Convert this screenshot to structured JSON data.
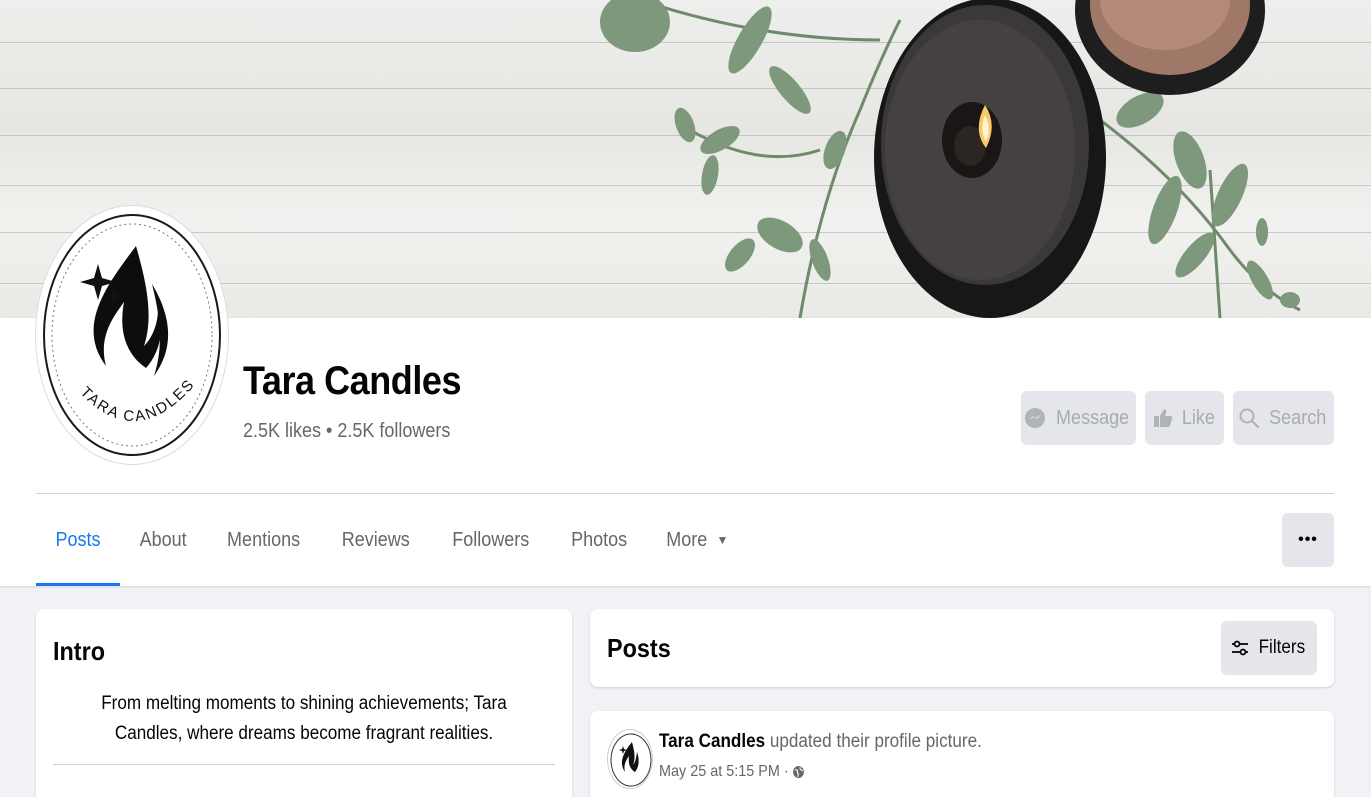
{
  "page": {
    "name": "Tara Candles",
    "stats": "2.5K likes • 2.5K followers",
    "logo_text": "TARA CANDLES"
  },
  "actions": {
    "message": "Message",
    "like": "Like",
    "search": "Search"
  },
  "tabs": [
    {
      "label": "Posts",
      "active": true
    },
    {
      "label": "About"
    },
    {
      "label": "Mentions"
    },
    {
      "label": "Reviews"
    },
    {
      "label": "Followers"
    },
    {
      "label": "Photos"
    },
    {
      "label": "More"
    }
  ],
  "more_options": "•••",
  "intro": {
    "title": "Intro",
    "bio": "From melting moments to shining achievements; Tara Candles, where dreams become fragrant realities."
  },
  "posts": {
    "title": "Posts",
    "filters_label": "Filters",
    "items": [
      {
        "author": "Tara Candles",
        "action": "updated their profile picture.",
        "timestamp": "May 25 at 5:15 PM ·"
      }
    ]
  },
  "colors": {
    "accent": "#1877f2",
    "muted_text": "#65676b",
    "button_bg": "#e4e6eb",
    "page_bg": "#f0f2f5"
  },
  "icons": [
    "messenger-icon",
    "thumbs-up-icon",
    "search-icon",
    "chevron-down-icon",
    "ellipsis-icon",
    "filters-icon",
    "globe-icon"
  ]
}
